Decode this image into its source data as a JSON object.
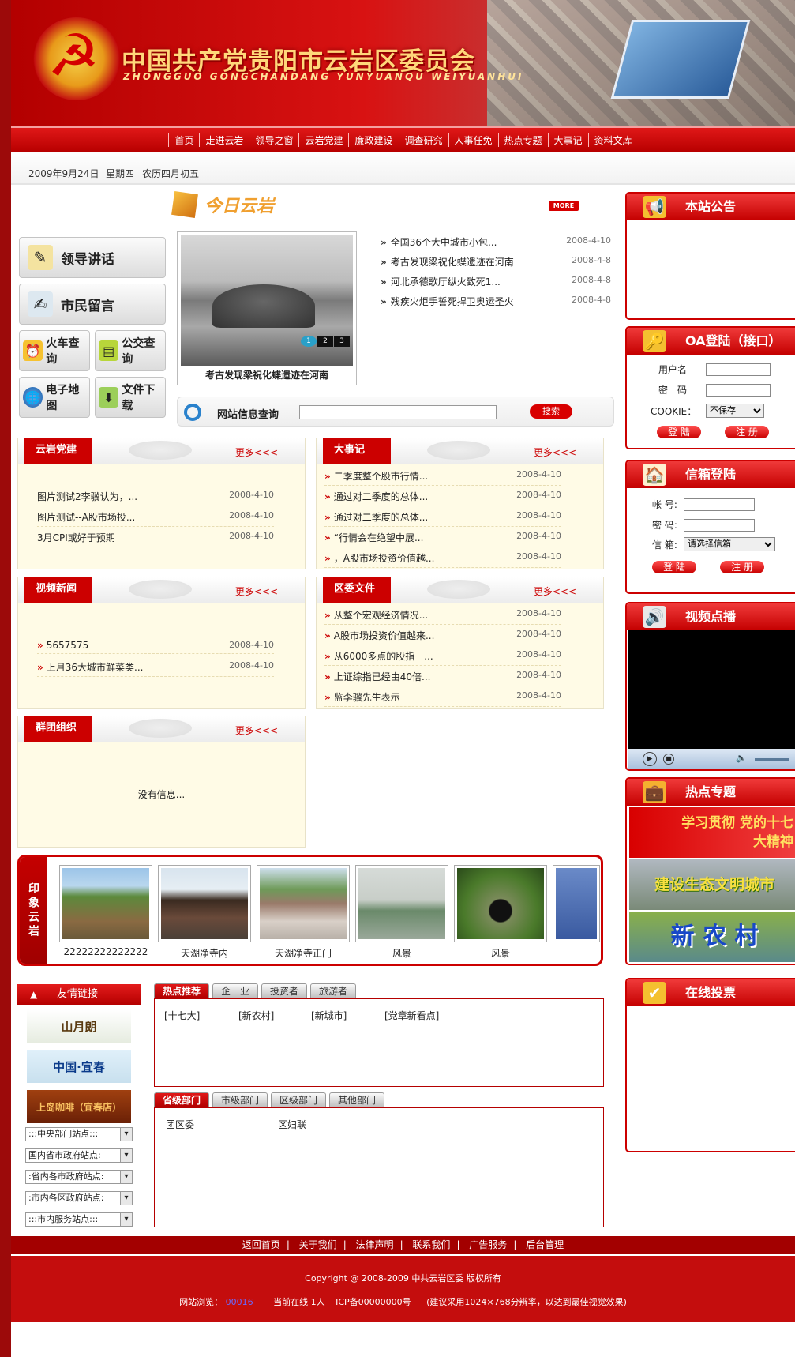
{
  "header": {
    "title": "中国共产党贵阳市云岩区委员会",
    "subtitle": "ZHONGGUO GONGCHANDANG YUNYUANQU WEIYUANHUI"
  },
  "nav": [
    "首页",
    "走进云岩",
    "领导之窗",
    "云岩党建",
    "廉政建设",
    "调查研究",
    "人事任免",
    "热点专题",
    "大事记",
    "资料文库"
  ],
  "datebar": {
    "date": "2009年9月24日",
    "weekday": "星期四",
    "lunar": "农历四月初五"
  },
  "side_buttons": {
    "leader": "领导讲话",
    "citizen": "市民留言",
    "train": "火车查询",
    "bus": "公交查询",
    "map": "电子地图",
    "download": "文件下载"
  },
  "today": {
    "title": "今日云岩",
    "more": "MORE",
    "photo_caption": "考古发现梁祝化蝶遗迹在河南",
    "pager": [
      "1",
      "2",
      "3"
    ],
    "news": [
      {
        "t": "全国36个大中城市小包...",
        "d": "2008-4-10"
      },
      {
        "t": "考古发现梁祝化蝶遗迹在河南",
        "d": "2008-4-8"
      },
      {
        "t": "河北承德歌厅纵火致死1...",
        "d": "2008-4-8"
      },
      {
        "t": "残疾火炬手誓死捍卫奥运圣火",
        "d": "2008-4-8"
      }
    ]
  },
  "search": {
    "label": "网站信息查询",
    "button": "搜索"
  },
  "more_label": "更多<<<",
  "party": {
    "title": "云岩党建",
    "items": [
      {
        "t": "图片测试2李骥认为，...",
        "d": "2008-4-10"
      },
      {
        "t": "图片测试--A股市场投...",
        "d": "2008-4-10"
      },
      {
        "t": "3月CPI或好于预期",
        "d": "2008-4-10"
      }
    ]
  },
  "events": {
    "title": "大事记",
    "items": [
      {
        "t": "二季度整个股市行情...",
        "d": "2008-4-10"
      },
      {
        "t": "通过对二季度的总体...",
        "d": "2008-4-10"
      },
      {
        "t": "通过对二季度的总体...",
        "d": "2008-4-10"
      },
      {
        "t": "“行情会在绝望中展...",
        "d": "2008-4-10"
      },
      {
        "t": "，A股市场投资价值越...",
        "d": "2008-4-10"
      }
    ]
  },
  "video_news": {
    "title": "视频新闻",
    "items": [
      {
        "t": "5657575",
        "d": "2008-4-10"
      },
      {
        "t": "上月36大城市鲜菜类...",
        "d": "2008-4-10"
      }
    ]
  },
  "docs": {
    "title": "区委文件",
    "items": [
      {
        "t": "从整个宏观经济情况...",
        "d": "2008-4-10"
      },
      {
        "t": "A股市场投资价值越来...",
        "d": "2008-4-10"
      },
      {
        "t": "从6000多点的股指一...",
        "d": "2008-4-10"
      },
      {
        "t": "上证综指已经由40倍...",
        "d": "2008-4-10"
      },
      {
        "t": "监李骥先生表示",
        "d": "2008-4-10"
      }
    ]
  },
  "groups": {
    "title": "群团组织",
    "empty": "没有信息..."
  },
  "impression": {
    "title": "印象云岩",
    "pics": [
      "22222222222222",
      "天湖净寺内",
      "天湖净寺正门",
      "风景",
      "风景"
    ]
  },
  "friends": {
    "title": "友情链接",
    "logos": [
      "山月朗",
      "中国·宜春",
      "上岛咖啡（宜春店）"
    ],
    "selects": [
      ":::中央部门站点:::",
      "国内省市政府站点:",
      ":省内各市政府站点:",
      ":市内各区政府站点:",
      ":::市内服务站点:::"
    ]
  },
  "hot_tabs": {
    "tabs": [
      "热点推荐",
      "企　业",
      "投资者",
      "旅游者"
    ],
    "keywords": [
      "[十七大]",
      "[新农村]",
      "[新城市]",
      "[党章新看点]"
    ]
  },
  "dept_tabs": {
    "tabs": [
      "省级部门",
      "市级部门",
      "区级部门",
      "其他部门"
    ],
    "items": [
      "团区委",
      "区妇联"
    ]
  },
  "right": {
    "notice": "本站公告",
    "oa": {
      "title": "OA登陆（接口）",
      "user": "用户名",
      "pwd": "密　码",
      "cookie": "COOKIE：",
      "cookie_value": "不保存",
      "login": "登 陆",
      "register": "注 册"
    },
    "mail": {
      "title": "信箱登陆",
      "account": "帐 号:",
      "pwd": "密 码:",
      "box": "信 箱:",
      "box_value": "请选择信箱",
      "login": "登 陆",
      "register": "注 册"
    },
    "video": "视频点播",
    "topics": {
      "title": "热点专题",
      "banners": [
        "学习贯彻 党的十七大精神",
        "建设生态文明城市",
        "新 农 村"
      ]
    },
    "vote": "在线投票"
  },
  "footer": {
    "links": [
      "返回首页",
      "关于我们",
      "法律声明",
      "联系我们",
      "广告服务",
      "后台管理"
    ],
    "copyright": "Copyright @ 2008-2009 中共云岩区委 版权所有",
    "visits_label": "网站浏览：",
    "visits": "00016",
    "online": "当前在线 1人",
    "icp": "ICP备00000000号",
    "tip": "(建议采用1024×768分辨率，以达到最佳视觉效果)"
  }
}
